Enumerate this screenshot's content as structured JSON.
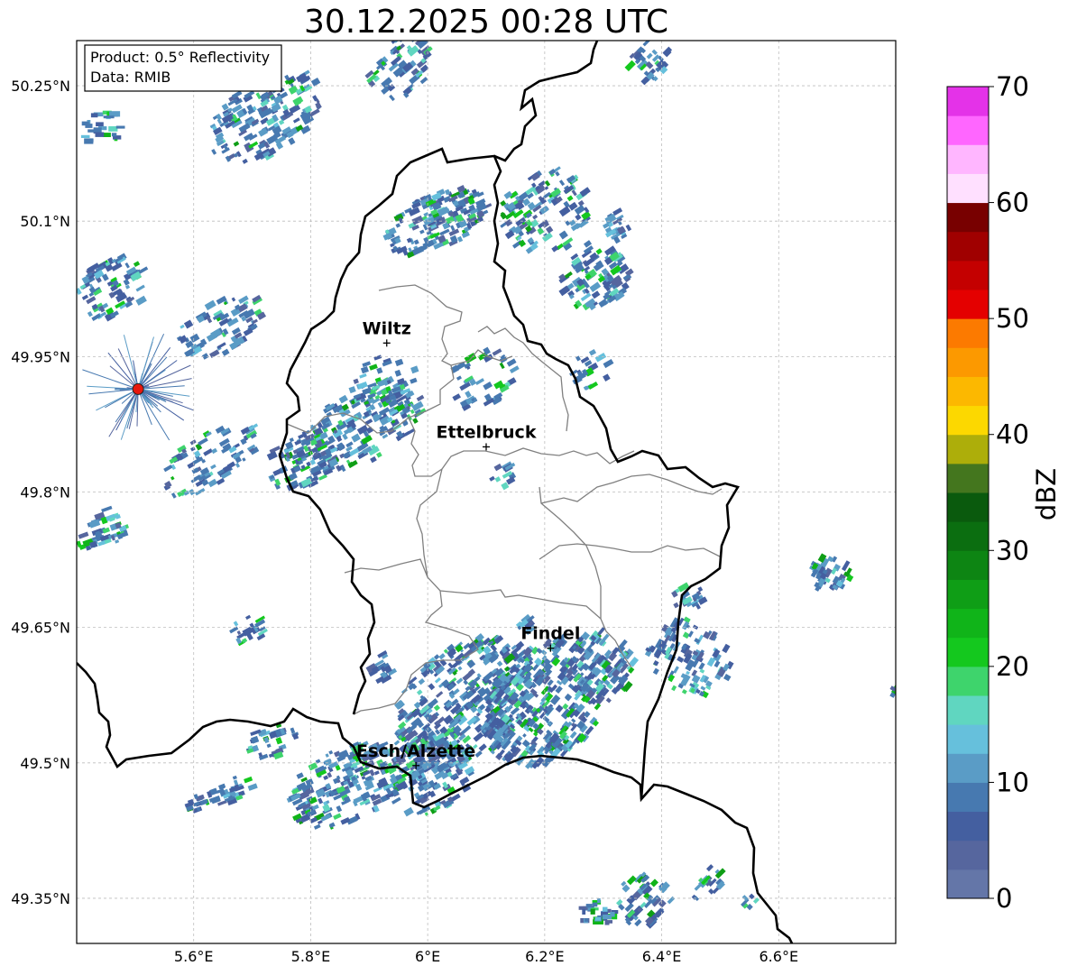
{
  "title": "30.12.2025 00:28 UTC",
  "info_box": {
    "product": "Product: 0.5° Reflectivity",
    "data": "Data: RMIB"
  },
  "lat_labels": [
    "50.25°N",
    "50.1°N",
    "49.95°N",
    "49.8°N",
    "49.65°N",
    "49.5°N",
    "49.35°N"
  ],
  "lon_labels": [
    "5.6°E",
    "5.8°E",
    "6°E",
    "6.2°E",
    "6.4°E",
    "6.6°E"
  ],
  "cities": [
    {
      "name": "Wiltz",
      "lon": 5.93,
      "lat": 49.965
    },
    {
      "name": "Ettelbruck",
      "lon": 6.1,
      "lat": 49.85
    },
    {
      "name": "Findel",
      "lon": 6.21,
      "lat": 49.627
    },
    {
      "name": "Esch/Alzette",
      "lon": 5.98,
      "lat": 49.497
    }
  ],
  "radar_site": {
    "name": "radar-site",
    "lon": 5.505,
    "lat": 49.914,
    "color": "#e8160c"
  },
  "colorbar": {
    "label": "dBZ",
    "ticks": [
      "0",
      "10",
      "20",
      "30",
      "40",
      "50",
      "60",
      "70"
    ],
    "min": 0,
    "max": 70,
    "step": 2.5,
    "colors": [
      "#6476a8",
      "#56669e",
      "#445fa0",
      "#4779b0",
      "#5a9cc6",
      "#66c0dc",
      "#60d6c0",
      "#3ed46c",
      "#14c81e",
      "#10b419",
      "#0f9e16",
      "#0d8513",
      "#0b6e10",
      "#0a5a0d",
      "#44761e",
      "#adae0a",
      "#fcd800",
      "#fcb800",
      "#fc9900",
      "#fc7a00",
      "#e40000",
      "#c40000",
      "#a00000",
      "#780000",
      "#ffe0ff",
      "#ffb6ff",
      "#ff66ff",
      "#e432e8"
    ]
  },
  "colors": {
    "border": "#000000",
    "canton": "#808080",
    "grid": "#bdbdbd",
    "background": "#ffffff"
  }
}
